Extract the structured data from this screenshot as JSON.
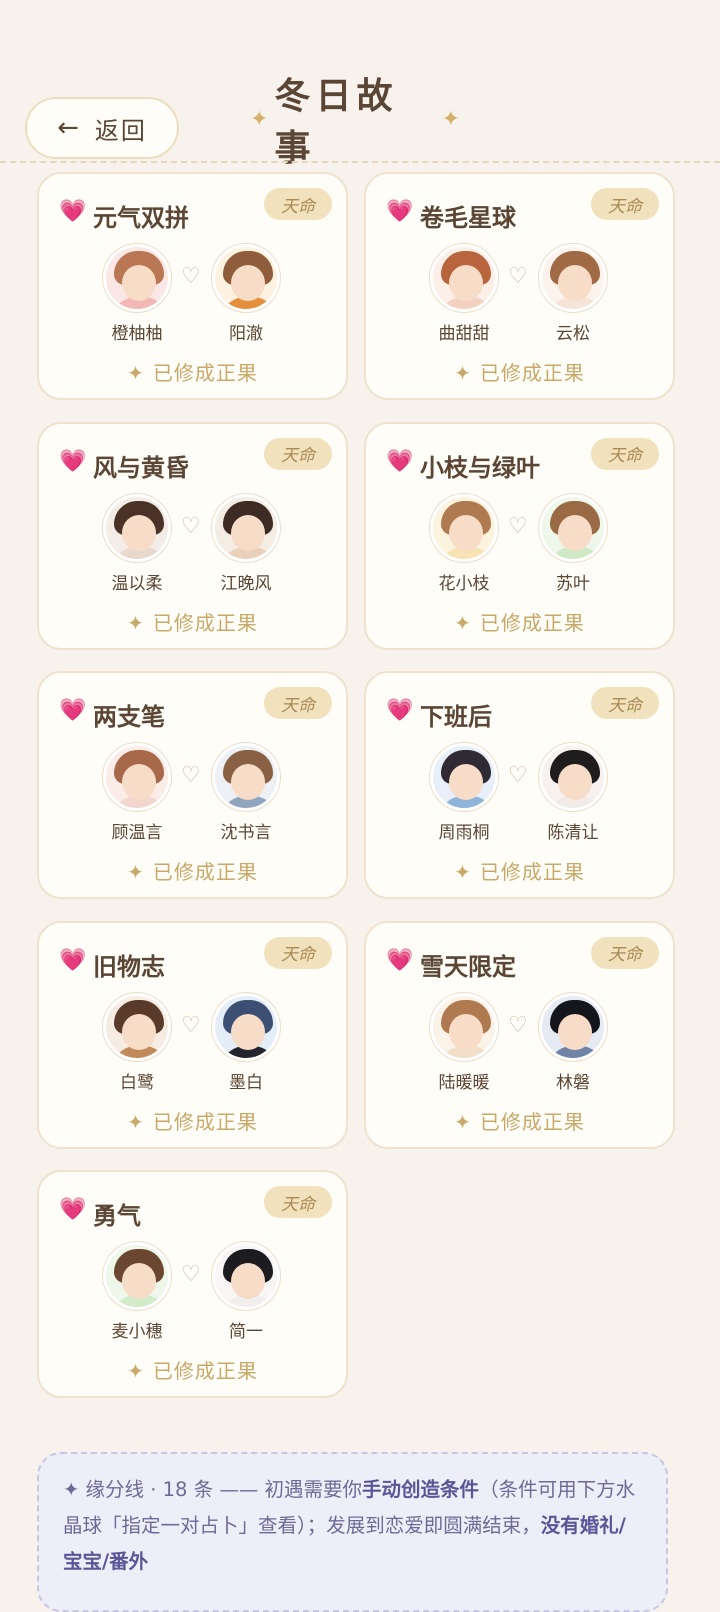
{
  "header": {
    "back_label": "返回",
    "back_arrow": "←",
    "title": "冬日故事",
    "title_spark": "✦"
  },
  "cards": [
    {
      "title": "元气双拼",
      "badge": "天命",
      "status": "已修成正果",
      "left": {
        "name": "橙柚柚",
        "hair": "#b97853",
        "body": "#f2b8b5",
        "bg": "#fbe8e6"
      },
      "right": {
        "name": "阳澈",
        "hair": "#8f5c3c",
        "body": "#e58f3d",
        "bg": "#fff2e0"
      }
    },
    {
      "title": "卷毛星球",
      "badge": "天命",
      "status": "已修成正果",
      "left": {
        "name": "曲甜甜",
        "hair": "#b8653d",
        "body": "#f3d1c0",
        "bg": "#fcefe7"
      },
      "right": {
        "name": "云松",
        "hair": "#a06a45",
        "body": "#f6e4d8",
        "bg": "#fbf3ec"
      }
    },
    {
      "title": "风与黄昏",
      "badge": "天命",
      "status": "已修成正果",
      "left": {
        "name": "温以柔",
        "hair": "#4a3227",
        "body": "#e9d8cc",
        "bg": "#f4ece6"
      },
      "right": {
        "name": "江晚风",
        "hair": "#3e2c24",
        "body": "#e8d0bb",
        "bg": "#f5ede4"
      }
    },
    {
      "title": "小枝与绿叶",
      "badge": "天命",
      "status": "已修成正果",
      "left": {
        "name": "花小枝",
        "hair": "#b07a50",
        "body": "#f7e3b4",
        "bg": "#fbf3de"
      },
      "right": {
        "name": "苏叶",
        "hair": "#9a6a45",
        "body": "#cfe9c6",
        "bg": "#eef7ea"
      }
    },
    {
      "title": "两支笔",
      "badge": "天命",
      "status": "已修成正果",
      "left": {
        "name": "顾温言",
        "hair": "#a8684a",
        "body": "#f2d7cf",
        "bg": "#fbece8"
      },
      "right": {
        "name": "沈书言",
        "hair": "#8a6045",
        "body": "#8fa5bd",
        "bg": "#edf1f5"
      }
    },
    {
      "title": "下班后",
      "badge": "天命",
      "status": "已修成正果",
      "left": {
        "name": "周雨桐",
        "hair": "#2f2a33",
        "body": "#8fb3d9",
        "bg": "#e8eff9"
      },
      "right": {
        "name": "陈清让",
        "hair": "#1f1c1e",
        "body": "#f1ebe8",
        "bg": "#f7f2f0"
      }
    },
    {
      "title": "旧物志",
      "badge": "天命",
      "status": "已修成正果",
      "left": {
        "name": "白鹭",
        "hair": "#5a3a2a",
        "body": "#c08a5b",
        "bg": "#f7ece2"
      },
      "right": {
        "name": "墨白",
        "hair": "#3d4e73",
        "body": "#24242c",
        "bg": "#e4eef8"
      }
    },
    {
      "title": "雪天限定",
      "badge": "天命",
      "status": "已修成正果",
      "left": {
        "name": "陆暖暖",
        "hair": "#b07a50",
        "body": "#f3dfc8",
        "bg": "#fbf2e8"
      },
      "right": {
        "name": "林磐",
        "hair": "#15161b",
        "body": "#6f83a5",
        "bg": "#e6ebf3"
      }
    },
    {
      "title": "勇气",
      "badge": "天命",
      "status": "已修成正果",
      "left": {
        "name": "麦小穗",
        "hair": "#6b4630",
        "body": "#d2ebc8",
        "bg": "#eef7ea"
      },
      "right": {
        "name": "简一",
        "hair": "#1b1b20",
        "body": "#f3eeee",
        "bg": "#f8f5f5"
      }
    }
  ],
  "note": {
    "icon": "✦",
    "part1": " 缘分线 · 18 条 —— 初遇需要你",
    "bold1": "手动创造条件",
    "part2": "（条件可用下方水晶球「指定一对占卜」查看）；发展到恋爱即圆满结束，",
    "bold2": "没有婚礼/宝宝/番外"
  },
  "colors": {
    "background": "#f7f3ec",
    "card": "#fffdf7",
    "badge": "#f2e1bd",
    "accent_gold": "#c8a96a",
    "heart_pink": "#e05a97",
    "note_bg": "#eeeef8"
  }
}
